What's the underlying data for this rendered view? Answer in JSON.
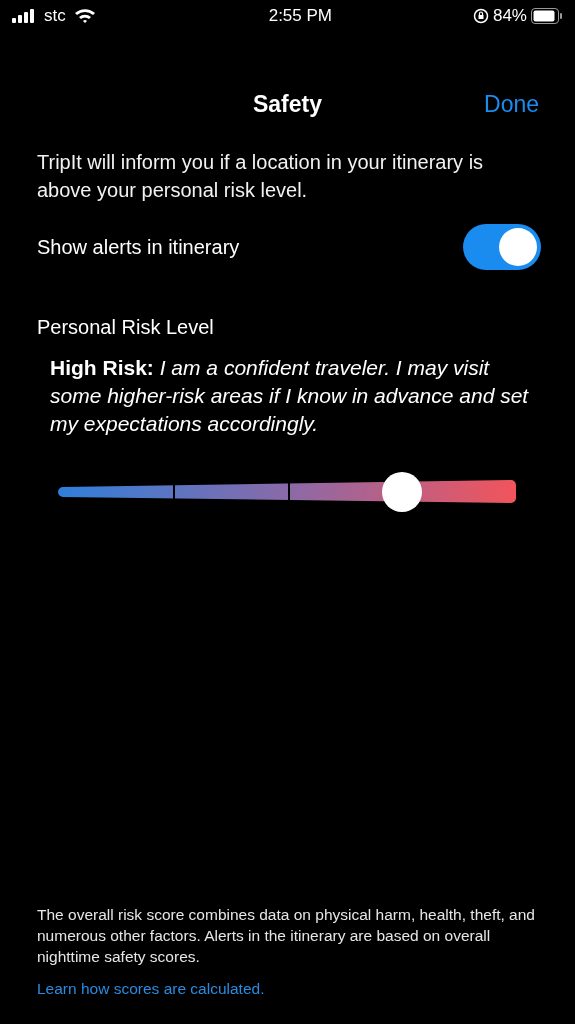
{
  "status_bar": {
    "carrier": "stc",
    "time": "2:55 PM",
    "battery": "84%"
  },
  "nav": {
    "title": "Safety",
    "done": "Done"
  },
  "intro": "TripIt will inform you if a location in your itinerary is above your personal risk level.",
  "alerts_toggle": {
    "label": "Show alerts in itinerary",
    "on": true
  },
  "risk": {
    "heading": "Personal Risk Level",
    "description": "**High Risk:** *I am a confident traveler. I may visit some higher-risk areas if I know in advance and set my expectations accordingly.*",
    "slider": {
      "level": 0.75
    }
  },
  "footer": {
    "note": "The overall risk score combines data on physical harm, health, theft, and numerous other factors. Alerts in the itinerary are based on overall nighttime safety scores.",
    "link": "Learn how scores are calculated."
  }
}
